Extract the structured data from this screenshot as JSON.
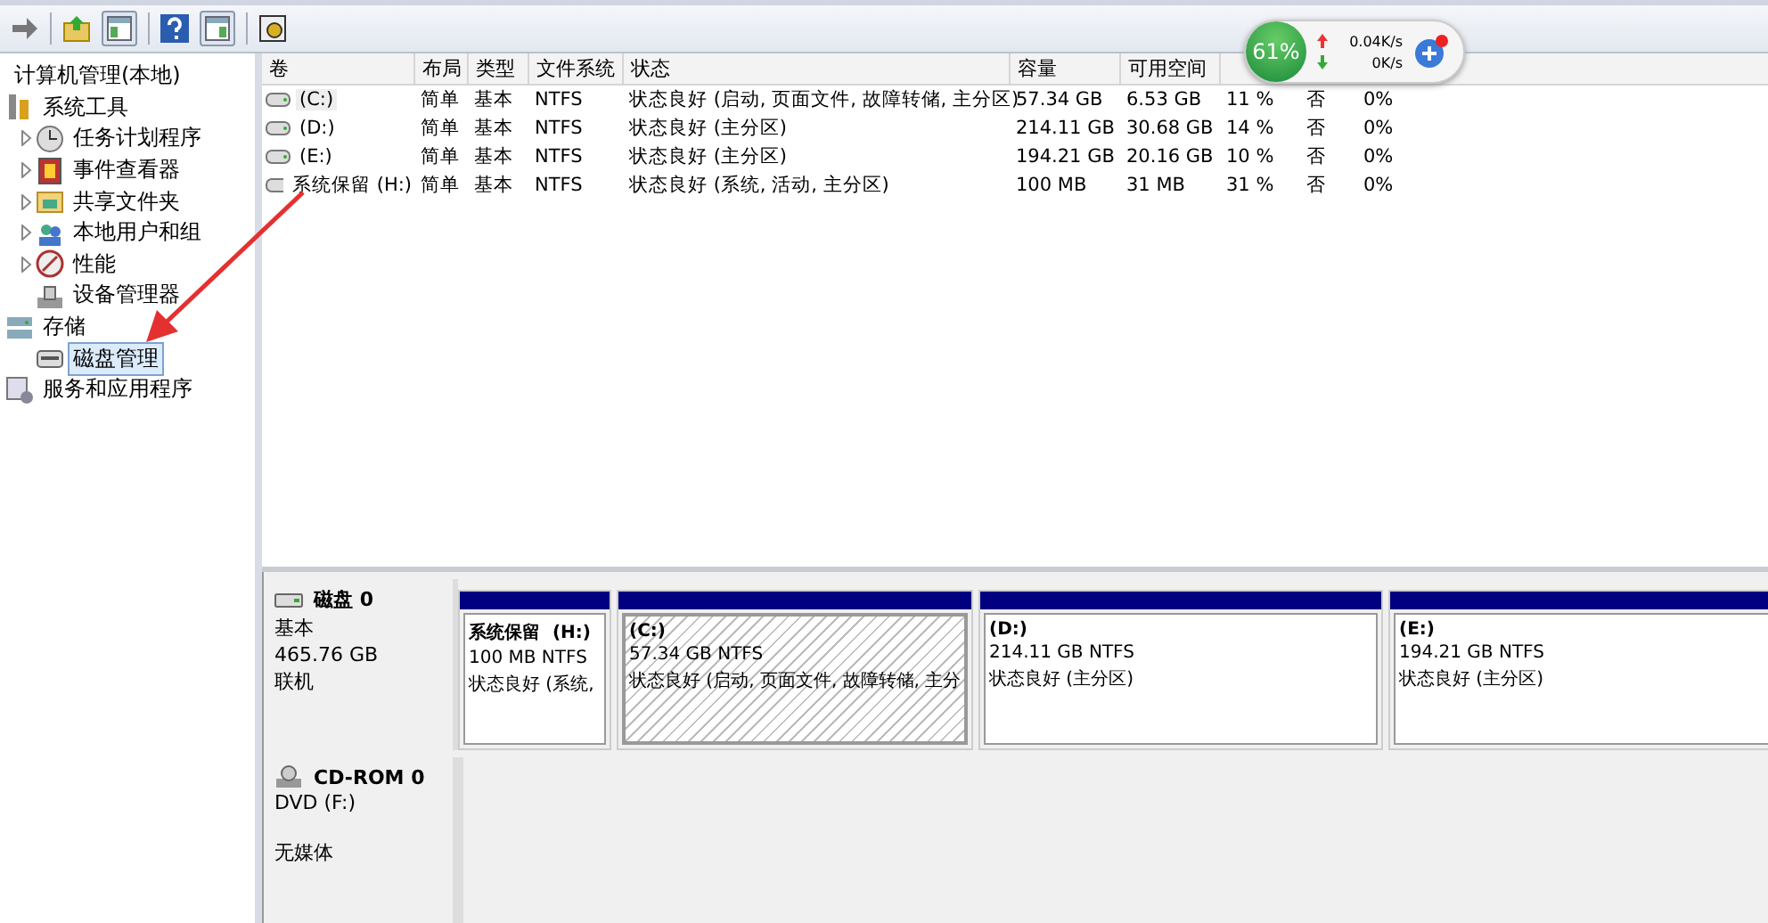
{
  "tree": {
    "label": "计算机管理(本地)",
    "children": [
      {
        "label": "系统工具",
        "expander": false,
        "selected": false,
        "children": [
          {
            "label": "任务计划程序",
            "expander": true,
            "selected": false
          },
          {
            "label": "事件查看器",
            "expander": true,
            "selected": false
          },
          {
            "label": "共享文件夹",
            "expander": true,
            "selected": false
          },
          {
            "label": "本地用户和组",
            "expander": true,
            "selected": false
          },
          {
            "label": "性能",
            "expander": true,
            "selected": false
          },
          {
            "label": "设备管理器",
            "expander": false,
            "selected": false
          }
        ]
      },
      {
        "label": "存储",
        "expander": false,
        "selected": false,
        "children": [
          {
            "label": "磁盘管理",
            "expander": false,
            "selected": true
          }
        ]
      },
      {
        "label": "服务和应用程序",
        "expander": false,
        "selected": false
      }
    ]
  },
  "volume_table": {
    "columns": [
      "卷",
      "布局",
      "类型",
      "文件系统",
      "状态",
      "容量",
      "可用空间"
    ],
    "rows": [
      {
        "selected": true,
        "cells": [
          "(C:)",
          "简单",
          "基本",
          "NTFS",
          "状态良好 (启动, 页面文件, 故障转储, 主分区)",
          "57.34 GB",
          "6.53 GB",
          "11 %",
          "否",
          "0%"
        ]
      },
      {
        "selected": false,
        "cells": [
          "(D:)",
          "简单",
          "基本",
          "NTFS",
          "状态良好 (主分区)",
          "214.11 GB",
          "30.68 GB",
          "14 %",
          "否",
          "0%"
        ]
      },
      {
        "selected": false,
        "cells": [
          "(E:)",
          "简单",
          "基本",
          "NTFS",
          "状态良好 (主分区)",
          "194.21 GB",
          "20.16 GB",
          "10 %",
          "否",
          "0%"
        ]
      },
      {
        "selected": false,
        "cells": [
          "系统保留 (H:)",
          "简单",
          "基本",
          "NTFS",
          "状态良好 (系统, 活动, 主分区)",
          "100 MB",
          "31 MB",
          "31 %",
          "否",
          "0%"
        ]
      }
    ]
  },
  "disks": [
    {
      "kind": "disk",
      "name": "磁盘 0",
      "type": "基本",
      "size": "465.76 GB",
      "status": "联机",
      "partitions": [
        {
          "name": "系统保留  (H:)",
          "size": "100 MB NTFS",
          "status": "状态良好 (系统,",
          "selected": false
        },
        {
          "name": "(C:)",
          "size": "57.34 GB NTFS",
          "status": "状态良好 (启动, 页面文件, 故障转储, 主分",
          "selected": true
        },
        {
          "name": "(D:)",
          "size": "214.11 GB NTFS",
          "status": "状态良好 (主分区)",
          "selected": false
        },
        {
          "name": "(E:)",
          "size": "194.21 GB NTFS",
          "status": "状态良好 (主分区)",
          "selected": false
        }
      ]
    },
    {
      "kind": "cdrom",
      "name": "CD-ROM 0",
      "type": "DVD (F:)",
      "status": "无媒体"
    }
  ],
  "speed_widget": {
    "percent": "61%",
    "upload": "0.04K/s",
    "download": "0K/s"
  }
}
